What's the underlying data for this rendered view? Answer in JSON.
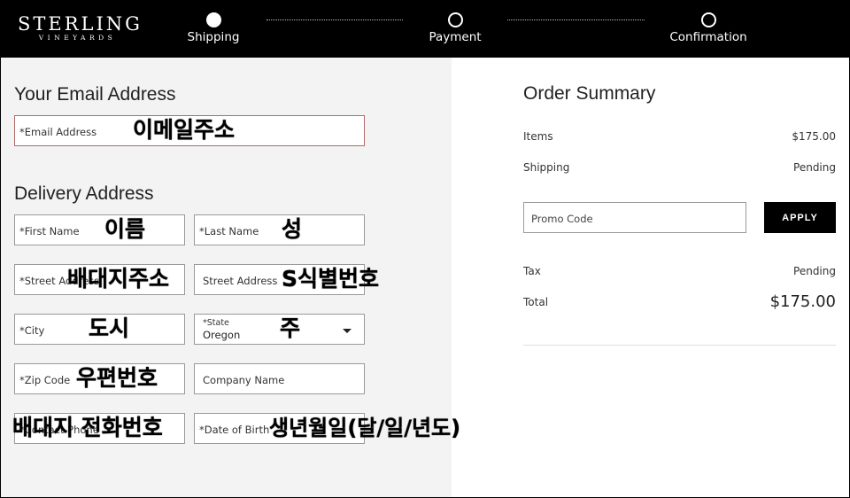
{
  "brand": {
    "line1": "STERLING",
    "line2": "VINEYARDS"
  },
  "steps": [
    {
      "label": "Shipping",
      "active": true
    },
    {
      "label": "Payment",
      "active": false
    },
    {
      "label": "Confirmation",
      "active": false
    }
  ],
  "email_section": {
    "title": "Your Email Address",
    "email_placeholder": "*Email Address",
    "email_annotation": "이메일주소"
  },
  "delivery_section": {
    "title": "Delivery Address",
    "first_name_placeholder": "*First Name",
    "first_name_annotation": "이름",
    "last_name_placeholder": "*Last Name",
    "last_name_annotation": "성",
    "street1_placeholder": "*Street Address",
    "street1_annotation": "배대지주소",
    "street2_placeholder": "Street Address",
    "street2_annotation": "S식별번호",
    "city_placeholder": "*City",
    "city_annotation": "도시",
    "state_label": "*State",
    "state_value": "Oregon",
    "state_annotation": "주",
    "zip_placeholder": "*Zip Code",
    "zip_annotation": "우편번호",
    "company_placeholder": "Company Name",
    "phone_placeholder": "*Contact Phone",
    "phone_annotation": "배대지 전화번호",
    "dob_placeholder": "*Date of Birth",
    "dob_annotation": "생년월일(달/일/년도)"
  },
  "order_summary": {
    "title": "Order Summary",
    "items_label": "Items",
    "items_value": "$175.00",
    "shipping_label": "Shipping",
    "shipping_value": "Pending",
    "promo_placeholder": "Promo Code",
    "apply_label": "APPLY",
    "tax_label": "Tax",
    "tax_value": "Pending",
    "total_label": "Total",
    "total_value": "$175.00"
  }
}
